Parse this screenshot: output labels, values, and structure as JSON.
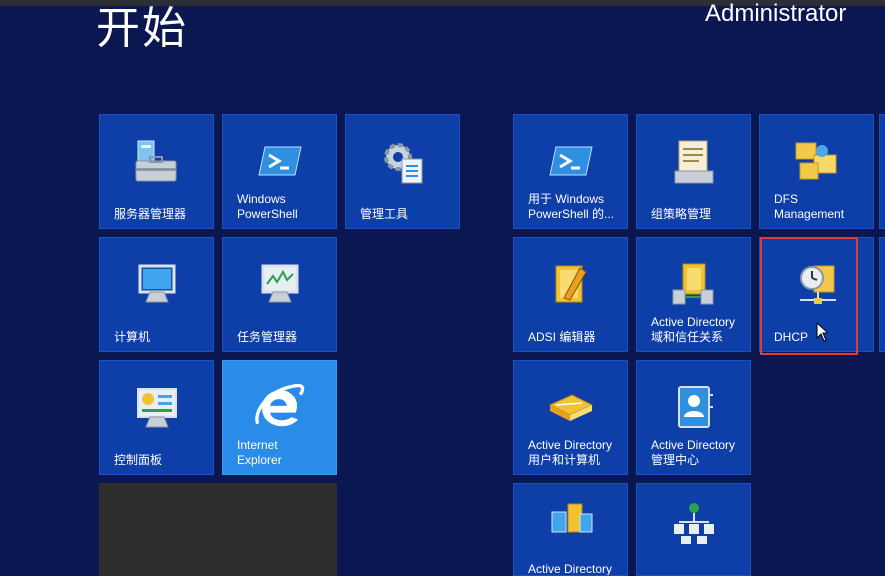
{
  "start": {
    "title": "开始",
    "user": "Administrator"
  },
  "tiles": {
    "server_manager": "服务器管理器",
    "powershell": "Windows\nPowerShell",
    "admin_tools": "管理工具",
    "ps_modules": "用于 Windows\nPowerShell 的...",
    "group_policy": "组策略管理",
    "dfs": "DFS\nManagement",
    "computer": "计算机",
    "task_manager": "任务管理器",
    "adsi": "ADSI 编辑器",
    "ad_domains": "Active Directory\n域和信任关系",
    "dhcp": "DHCP",
    "control_panel": "控制面板",
    "ie": "Internet\nExplorer",
    "ad_users": "Active Directory\n用户和计算机",
    "ad_admin_center": "Active Directory\n管理中心",
    "ad_sites": "Active Directory"
  },
  "icons": {
    "server_manager": "server-toolbox-icon",
    "powershell": "powershell-icon",
    "admin_tools": "gear-document-icon",
    "ps_modules": "powershell-icon",
    "group_policy": "policy-scroll-icon",
    "dfs": "folder-tree-icon",
    "computer": "monitor-icon",
    "task_manager": "monitor-chart-icon",
    "adsi": "notebook-pencil-icon",
    "ad_domains": "domain-trust-icon",
    "dhcp": "dhcp-clock-network-icon",
    "control_panel": "control-panel-icon",
    "ie": "internet-explorer-icon",
    "ad_users": "address-book-icon",
    "ad_admin_center": "ad-admin-center-icon",
    "ad_sites": "ad-sites-icon",
    "mouse_cursor": "mouse-cursor-icon"
  }
}
